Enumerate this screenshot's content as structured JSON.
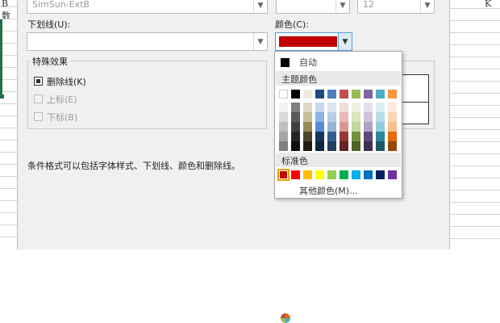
{
  "sheet": {
    "column_header": "K",
    "cell_text": "B数"
  },
  "font_name_field": {
    "value": "SimSun-ExtB"
  },
  "font_size_field": {
    "value": "12"
  },
  "underline": {
    "label": "下划线(U):",
    "value": ""
  },
  "color": {
    "label": "颜色(C):",
    "current_value": "#c00000"
  },
  "effects": {
    "title": "特殊效果",
    "strikethrough": {
      "label": "删除线(K)",
      "checked": true
    },
    "superscript": {
      "label": "上标(E)",
      "checked": false,
      "enabled": false
    },
    "subscript": {
      "label": "下标(B)",
      "checked": false,
      "enabled": false
    }
  },
  "note": "条件格式可以包括字体样式、下划线、颜色和删除线。",
  "color_menu": {
    "automatic_label": "自动",
    "theme_colors_label": "主题颜色",
    "standard_colors_label": "标准色",
    "more_colors_label": "其他颜色(M)...",
    "theme_colors": [
      [
        "#ffffff",
        "#f2f2f2",
        "#d9d9d9",
        "#bfbfbf",
        "#a6a6a6",
        "#808080"
      ],
      [
        "#000000",
        "#7f7f7f",
        "#595959",
        "#404040",
        "#262626",
        "#0d0d0d"
      ],
      [
        "#eeece1",
        "#ddd9c4",
        "#c4bd97",
        "#948a54",
        "#4a452a",
        "#1e1c11"
      ],
      [
        "#1f497d",
        "#c6d9f0",
        "#8db3e2",
        "#548dd4",
        "#17365d",
        "#0f243e"
      ],
      [
        "#4f81bd",
        "#dbe5f1",
        "#b8cce4",
        "#95b3d7",
        "#366092",
        "#244061"
      ],
      [
        "#c0504d",
        "#f2dcdb",
        "#e6b8b7",
        "#da9694",
        "#953735",
        "#632523"
      ],
      [
        "#9bbb59",
        "#ebf1dd",
        "#d7e4bc",
        "#c3d69b",
        "#76923c",
        "#4f6228"
      ],
      [
        "#8064a2",
        "#e5e0ec",
        "#ccc1d9",
        "#b2a2c7",
        "#5f497a",
        "#3f3151"
      ],
      [
        "#4bacc6",
        "#dbeef3",
        "#b7dde8",
        "#92cddc",
        "#31859b",
        "#205867"
      ],
      [
        "#f79646",
        "#fdeada",
        "#fbd5b5",
        "#fac08f",
        "#e36c09",
        "#974806"
      ]
    ],
    "standard_colors": [
      "#c00000",
      "#ff0000",
      "#ffc000",
      "#ffff00",
      "#92d050",
      "#00b050",
      "#00b0f0",
      "#0070c0",
      "#002060",
      "#7030a0"
    ],
    "selected_standard_index": 0
  }
}
